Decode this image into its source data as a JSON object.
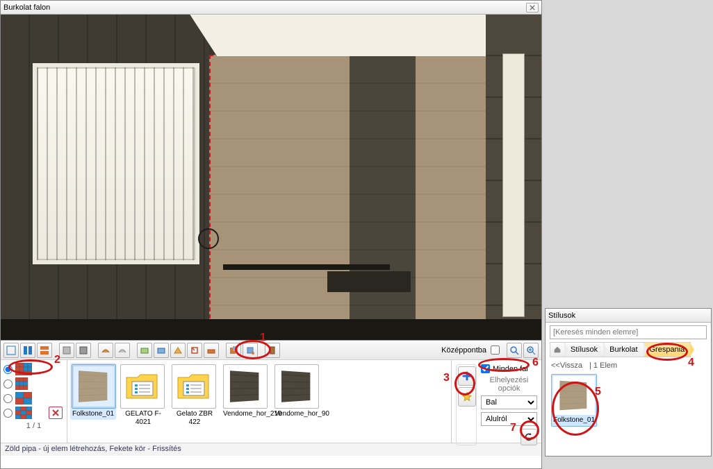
{
  "window": {
    "title": "Burkolat falon"
  },
  "toolbar": {
    "center_label": "Középpontba",
    "center_checked": false
  },
  "modes": {
    "counter": "1 / 1"
  },
  "thumbs": [
    {
      "name": "Folkstone_01",
      "kind": "tile-light",
      "selected": true
    },
    {
      "name": "GELATO F-4021",
      "kind": "folder"
    },
    {
      "name": "Gelato ZBR 422",
      "kind": "folder"
    },
    {
      "name": "Vendome_hor_210",
      "kind": "tile-dark"
    },
    {
      "name": "Vendome_hor_90",
      "kind": "tile-dark"
    }
  ],
  "side": {
    "all_walls_label": "Minden fal",
    "all_walls_checked": true,
    "options_title": "Elhelyezési opciók",
    "sel_align": "Bal",
    "sel_from": "Alulról"
  },
  "status": {
    "text": "Zöld pipa - új elem létrehozás, Fekete kör - Frissítés"
  },
  "panel": {
    "title": "Stílusok",
    "search_placeholder": "[Keresés minden elemre]",
    "breadcrumb": [
      "Stílusok",
      "Burkolat",
      "Grespania"
    ],
    "back_label": "<<Vissza",
    "count_label": "| 1 Elem",
    "item_name": "Folkstone_01"
  },
  "annotations": {
    "1": "1",
    "2": "2",
    "3": "3",
    "4": "4",
    "5": "5",
    "6": "6",
    "7": "7"
  }
}
